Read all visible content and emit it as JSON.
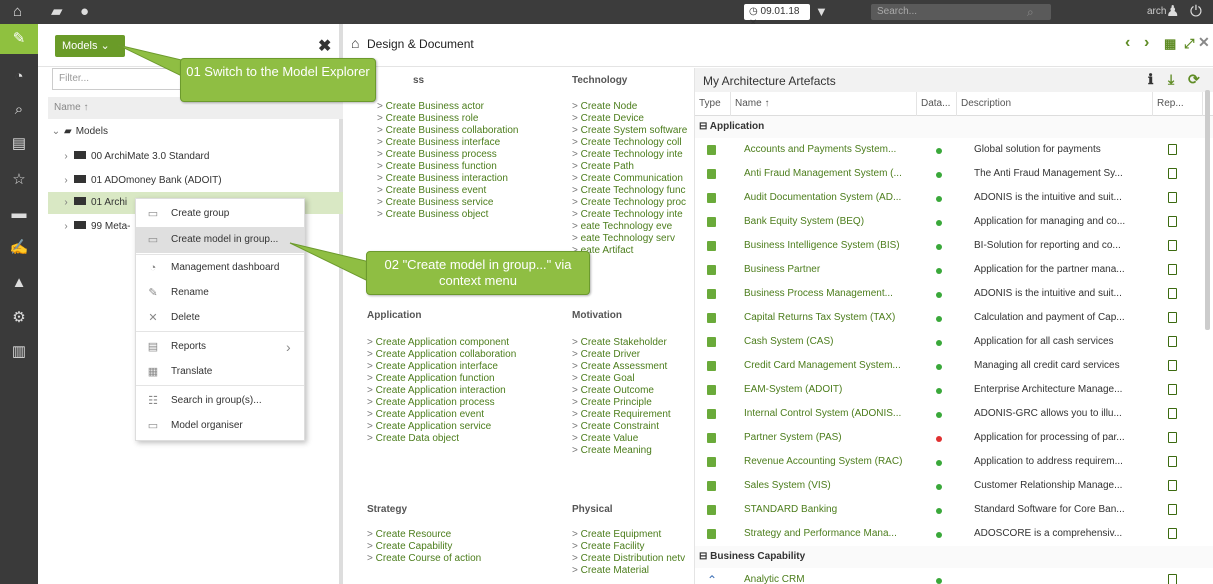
{
  "topbar": {
    "date": "09.01.18",
    "search_placeholder": "Search...",
    "user": "arch"
  },
  "explorer": {
    "models_button": "Models",
    "filter_placeholder": "Filter...",
    "name_header": "Name ↑",
    "root": "Models",
    "items": [
      "00 ArchiMate 3.0 Standard",
      "01 ADOmoney Bank (ADOIT)",
      "01 Archi",
      "99 Meta-"
    ]
  },
  "context_menu": {
    "items": [
      "Create group",
      "Create model in group...",
      "Management dashboard",
      "Rename",
      "Delete",
      "Reports",
      "Translate",
      "Search in group(s)...",
      "Model organiser"
    ]
  },
  "callouts": {
    "first": "01 Switch to the Model Explorer",
    "second": "02 \"Create model in group...\" via context menu"
  },
  "design": {
    "title": "Design & Document",
    "business_title": "ss",
    "business": [
      "Create Business actor",
      "Create Business role",
      "Create Business collaboration",
      "Create Business interface",
      "Create Business process",
      "Create Business function",
      "Create Business interaction",
      "Create Business event",
      "Create Business service",
      "Create Business object"
    ],
    "technology_title": "Technology",
    "technology": [
      "Create Node",
      "Create Device",
      "Create System software",
      "Create Technology coll",
      "Create Technology inte",
      "Create Path",
      "Create Communication",
      "Create Technology func",
      "Create Technology proc",
      "Create Technology inte",
      "eate Technology eve",
      "eate Technology serv",
      "eate Artifact"
    ],
    "application_title": "Application",
    "application": [
      "Create Application component",
      "Create Application collaboration",
      "Create Application interface",
      "Create Application function",
      "Create Application interaction",
      "Create Application process",
      "Create Application event",
      "Create Application service",
      "Create Data object"
    ],
    "motivation_title": "Motivation",
    "motivation": [
      "Create Stakeholder",
      "Create Driver",
      "Create Assessment",
      "Create Goal",
      "Create Outcome",
      "Create Principle",
      "Create Requirement",
      "Create Constraint",
      "Create Value",
      "Create Meaning"
    ],
    "strategy_title": "Strategy",
    "strategy": [
      "Create Resource",
      "Create Capability",
      "Create Course of action"
    ],
    "physical_title": "Physical",
    "physical": [
      "Create Equipment",
      "Create Facility",
      "Create Distribution netv",
      "Create Material"
    ]
  },
  "artefacts": {
    "title": "My Architecture Artefacts",
    "headers": {
      "type": "Type",
      "name": "Name ↑",
      "data": "Data...",
      "description": "Description",
      "rep": "Rep..."
    },
    "group1": "Application",
    "rows": [
      {
        "name": "Accounts and Payments System...",
        "desc": "Global solution for payments",
        "status": "#3aa83a"
      },
      {
        "name": "Anti Fraud Management System (...",
        "desc": "The Anti Fraud Management Sy...",
        "status": "#3aa83a"
      },
      {
        "name": "Audit Documentation System (AD...",
        "desc": "ADONIS is the intuitive and suit...",
        "status": "#3aa83a"
      },
      {
        "name": "Bank Equity System (BEQ)",
        "desc": "Application for managing and co...",
        "status": "#3aa83a"
      },
      {
        "name": "Business Intelligence System (BIS)",
        "desc": "BI-Solution for reporting and co...",
        "status": "#3aa83a"
      },
      {
        "name": "Business Partner",
        "desc": "Application for the partner mana...",
        "status": "#3aa83a"
      },
      {
        "name": "Business Process Management...",
        "desc": "ADONIS is the intuitive and suit...",
        "status": "#3aa83a"
      },
      {
        "name": "Capital Returns Tax System (TAX)",
        "desc": "Calculation and payment of Cap...",
        "status": "#3aa83a"
      },
      {
        "name": "Cash System (CAS)",
        "desc": "Application for all cash services",
        "status": "#3aa83a"
      },
      {
        "name": "Credit Card Management System...",
        "desc": "Managing all credit card services",
        "status": "#3aa83a"
      },
      {
        "name": "EAM-System (ADOIT)",
        "desc": "Enterprise Architecture Manage...",
        "status": "#3aa83a"
      },
      {
        "name": "Internal Control System (ADONIS...",
        "desc": "ADONIS-GRC allows you to illu...",
        "status": "#3aa83a"
      },
      {
        "name": "Partner System (PAS)",
        "desc": "Application for processing of par...",
        "status": "#e03030"
      },
      {
        "name": "Revenue Accounting System (RAC)",
        "desc": "Application to address requirem...",
        "status": "#3aa83a"
      },
      {
        "name": "Sales System (VIS)",
        "desc": "Customer Relationship Manage...",
        "status": "#3aa83a"
      },
      {
        "name": "STANDARD Banking",
        "desc": "Standard Software for Core Ban...",
        "status": "#3aa83a"
      },
      {
        "name": "Strategy and Performance Mana...",
        "desc": "ADOSCORE is a comprehensiv...",
        "status": "#3aa83a"
      }
    ],
    "group2": "Business Capability",
    "row2": {
      "name": "Analytic CRM",
      "status": "#3aa83a"
    }
  }
}
